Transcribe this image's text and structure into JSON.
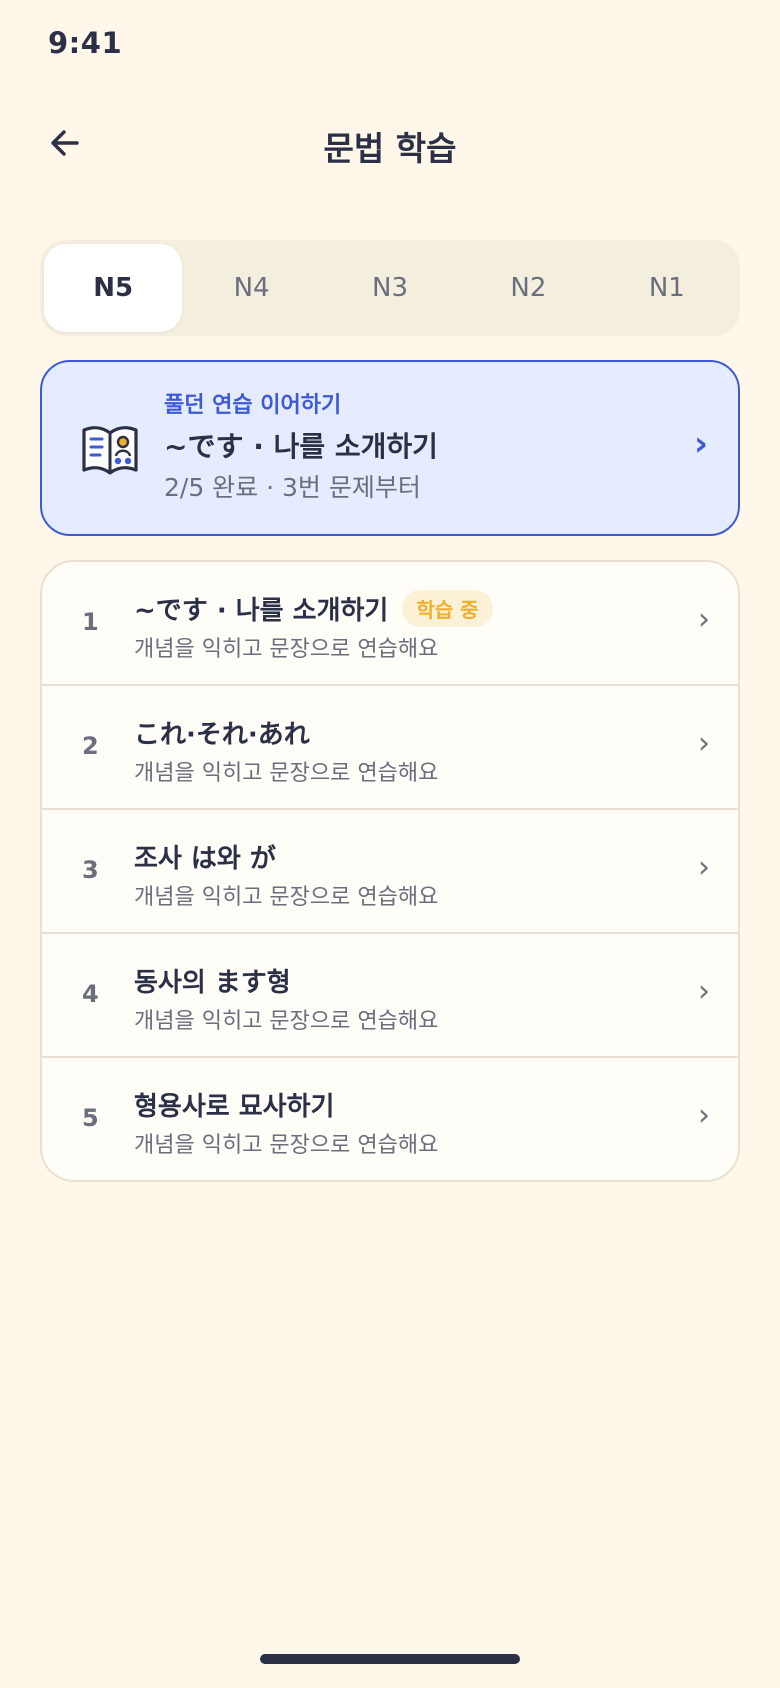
{
  "status_bar": {
    "time": "9:41"
  },
  "header": {
    "title": "문법 학습",
    "back_icon": "arrow-left-icon"
  },
  "level_tabs": [
    {
      "label": "N5",
      "active": true
    },
    {
      "label": "N4",
      "active": false
    },
    {
      "label": "N3",
      "active": false
    },
    {
      "label": "N2",
      "active": false
    },
    {
      "label": "N1",
      "active": false
    }
  ],
  "resume_card": {
    "kicker": "풀던 연습 이어하기",
    "title": "~です · 나를 소개하기",
    "progress": "2/5 완료 · 3번 문제부터",
    "icon": "open-book-icon",
    "chevron": "›"
  },
  "lessons": [
    {
      "number": "1",
      "title": "~です · 나를 소개하기",
      "badge": "학습 중",
      "subtitle": "개념을 익히고 문장으로 연습해요",
      "chevron": "›"
    },
    {
      "number": "2",
      "title": "これ·それ·あれ",
      "subtitle": "개념을 익히고 문장으로 연습해요",
      "chevron": "›"
    },
    {
      "number": "3",
      "title": "조사 は와 が",
      "subtitle": "개념을 익히고 문장으로 연습해요",
      "chevron": "›"
    },
    {
      "number": "4",
      "title": "동사의 ます형",
      "subtitle": "개념을 익히고 문장으로 연습해요",
      "chevron": "›"
    },
    {
      "number": "5",
      "title": "형용사로 묘사하기",
      "subtitle": "개념을 익히고 문장으로 연습해요",
      "chevron": "›"
    }
  ],
  "colors": {
    "background": "#FFF8EA",
    "primary": "#3D5BD8",
    "text": "#2B3046",
    "muted": "#6B6E7C",
    "badge_text": "#F1AE2B",
    "badge_bg": "#FBF1D7",
    "card_blue": "#E6ECFF"
  }
}
